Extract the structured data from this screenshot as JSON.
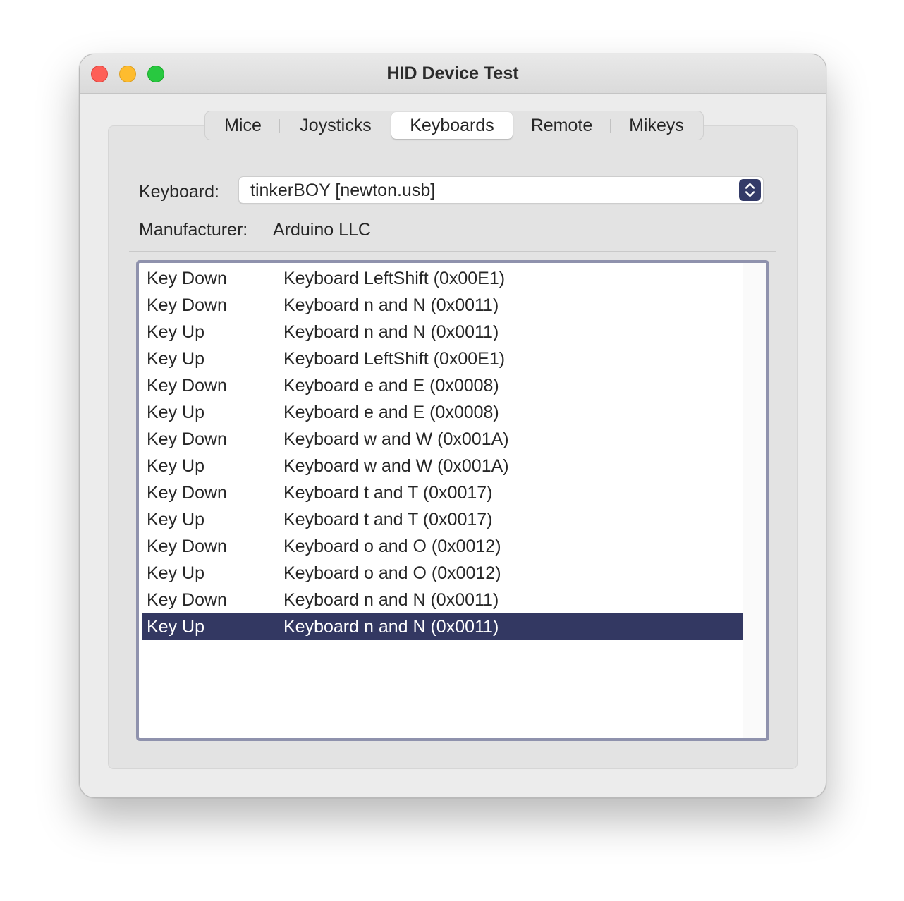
{
  "window": {
    "title": "HID Device Test"
  },
  "tabs": [
    "Mice",
    "Joysticks",
    "Keyboards",
    "Remote",
    "Mikeys"
  ],
  "active_tab": "Keyboards",
  "keyboard": {
    "label": "Keyboard:",
    "selected": "tinkerBOY [newton.usb]"
  },
  "manufacturer": {
    "label": "Manufacturer:",
    "value": "Arduino LLC"
  },
  "events": [
    {
      "action": "Key Down",
      "key": "Keyboard LeftShift (0x00E1)"
    },
    {
      "action": "Key Down",
      "key": "Keyboard n and N (0x0011)"
    },
    {
      "action": "Key Up",
      "key": "Keyboard n and N (0x0011)"
    },
    {
      "action": "Key Up",
      "key": "Keyboard LeftShift (0x00E1)"
    },
    {
      "action": "Key Down",
      "key": "Keyboard e and E (0x0008)"
    },
    {
      "action": "Key Up",
      "key": "Keyboard e and E (0x0008)"
    },
    {
      "action": "Key Down",
      "key": "Keyboard w and W (0x001A)"
    },
    {
      "action": "Key Up",
      "key": "Keyboard w and W (0x001A)"
    },
    {
      "action": "Key Down",
      "key": "Keyboard t and T (0x0017)"
    },
    {
      "action": "Key Up",
      "key": "Keyboard t and T (0x0017)"
    },
    {
      "action": "Key Down",
      "key": "Keyboard o and O (0x0012)"
    },
    {
      "action": "Key Up",
      "key": "Keyboard o and O (0x0012)"
    },
    {
      "action": "Key Down",
      "key": "Keyboard n and N (0x0011)"
    },
    {
      "action": "Key Up",
      "key": "Keyboard n and N (0x0011)"
    }
  ],
  "selected_event_index": 13,
  "colors": {
    "selection": "#333862",
    "accent": "#343b68",
    "close": "#fe5f57",
    "minimize": "#febc2e",
    "zoom": "#28c840"
  }
}
